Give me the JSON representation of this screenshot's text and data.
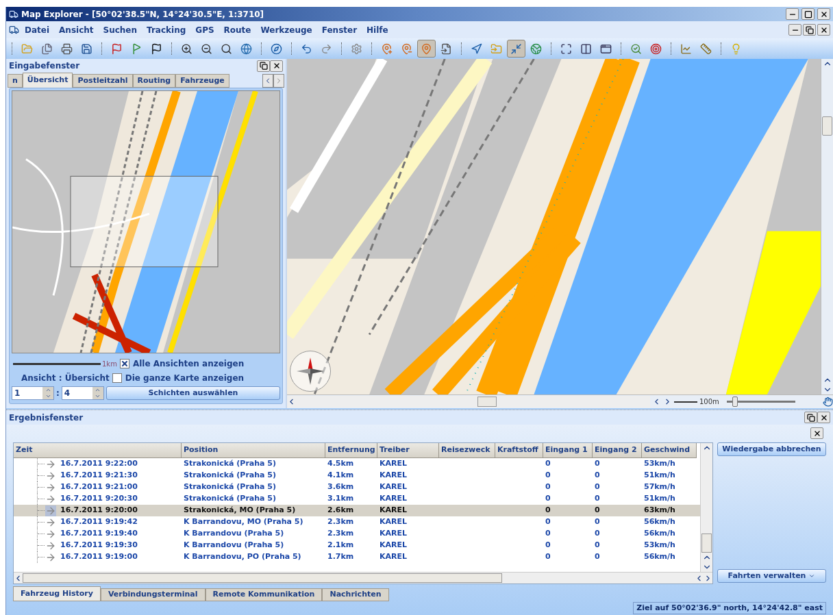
{
  "window": {
    "title": "Map Explorer - [50°02'38.5\"N, 14°24'30.5\"E, 1:3710]"
  },
  "menu": [
    "Datei",
    "Ansicht",
    "Suchen",
    "Tracking",
    "GPS",
    "Route",
    "Werkzeuge",
    "Fenster",
    "Hilfe"
  ],
  "toolbar": [
    {
      "kind": "separator"
    },
    {
      "kind": "open",
      "pressed": false
    },
    {
      "kind": "copy",
      "pressed": false
    },
    {
      "kind": "print",
      "pressed": false
    },
    {
      "kind": "save",
      "pressed": false
    },
    {
      "kind": "separator"
    },
    {
      "kind": "flag-start",
      "pressed": false
    },
    {
      "kind": "flag-via",
      "pressed": false
    },
    {
      "kind": "flag-finish",
      "pressed": false
    },
    {
      "kind": "separator"
    },
    {
      "kind": "zoom-in",
      "pressed": false
    },
    {
      "kind": "zoom-out",
      "pressed": false
    },
    {
      "kind": "zoom-100",
      "pressed": false
    },
    {
      "kind": "globe",
      "pressed": false
    },
    {
      "kind": "separator"
    },
    {
      "kind": "compass",
      "pressed": false
    },
    {
      "kind": "separator"
    },
    {
      "kind": "undo",
      "pressed": false
    },
    {
      "kind": "redo",
      "pressed": false
    },
    {
      "kind": "separator"
    },
    {
      "kind": "settings",
      "pressed": false
    },
    {
      "kind": "separator"
    },
    {
      "kind": "pin-add",
      "pressed": false
    },
    {
      "kind": "pin-remove",
      "pressed": false
    },
    {
      "kind": "pin",
      "pressed": true
    },
    {
      "kind": "document",
      "pressed": false
    },
    {
      "kind": "separator"
    },
    {
      "kind": "navigate",
      "pressed": false
    },
    {
      "kind": "folder",
      "pressed": false
    },
    {
      "kind": "fit",
      "pressed": true
    },
    {
      "kind": "globe-arrow",
      "pressed": false
    },
    {
      "kind": "separator"
    },
    {
      "kind": "fullscreen",
      "pressed": false
    },
    {
      "kind": "columns",
      "pressed": false
    },
    {
      "kind": "windows",
      "pressed": false
    },
    {
      "kind": "separator"
    },
    {
      "kind": "find",
      "pressed": false
    },
    {
      "kind": "target",
      "pressed": false
    },
    {
      "kind": "separator"
    },
    {
      "kind": "chart",
      "pressed": false
    },
    {
      "kind": "ruler",
      "pressed": false
    },
    {
      "kind": "separator"
    },
    {
      "kind": "bulb",
      "pressed": false
    }
  ],
  "input_panel": {
    "title": "Eingabefenster",
    "tabs": [
      {
        "label": "n",
        "selected": false
      },
      {
        "label": "Übersicht",
        "selected": true
      },
      {
        "label": "Postleitzahl",
        "selected": false
      },
      {
        "label": "Routing",
        "selected": false
      },
      {
        "label": "Fahrzeuge",
        "selected": false
      }
    ],
    "scale": "1km",
    "checkboxes": [
      {
        "label": "Alle Ansichten anzeigen",
        "checked": true
      },
      {
        "label": "Die ganze Karte anzeigen",
        "checked": false
      }
    ],
    "view_label": "Ansicht : Übersicht",
    "spinner_from": "1",
    "separator": ":",
    "spinner_to": "4",
    "layers_button": "Schichten auswählen"
  },
  "map": {
    "scale": "100m",
    "zoom": {
      "level": 0.12
    }
  },
  "results_panel": {
    "title": "Ergebnisfenster",
    "columns": [
      "Zeit",
      "Position",
      "Entfernung",
      "Treiber",
      "Reisezweck",
      "Kraftstoff",
      "Eingang 1",
      "Eingang 2",
      "Geschwind"
    ],
    "rows": [
      {
        "selected": false,
        "cells": [
          "16.7.2011 9:22:00",
          "Strakonická (Praha 5)",
          "4.5km",
          "KAREL",
          "",
          "",
          "0",
          "0",
          "53km/h"
        ]
      },
      {
        "selected": false,
        "cells": [
          "16.7.2011 9:21:30",
          "Strakonická (Praha 5)",
          "4.1km",
          "KAREL",
          "",
          "",
          "0",
          "0",
          "51km/h"
        ]
      },
      {
        "selected": false,
        "cells": [
          "16.7.2011 9:21:00",
          "Strakonická (Praha 5)",
          "3.6km",
          "KAREL",
          "",
          "",
          "0",
          "0",
          "57km/h"
        ]
      },
      {
        "selected": false,
        "cells": [
          "16.7.2011 9:20:30",
          "Strakonická (Praha 5)",
          "3.1km",
          "KAREL",
          "",
          "",
          "0",
          "0",
          "51km/h"
        ]
      },
      {
        "selected": true,
        "cells": [
          "16.7.2011 9:20:00",
          "Strakonická, MO (Praha 5)",
          "2.6km",
          "KAREL",
          "",
          "",
          "0",
          "0",
          "63km/h"
        ]
      },
      {
        "selected": false,
        "cells": [
          "16.7.2011 9:19:42",
          "K Barrandovu, MO (Praha 5)",
          "2.3km",
          "KAREL",
          "",
          "",
          "0",
          "0",
          "56km/h"
        ]
      },
      {
        "selected": false,
        "cells": [
          "16.7.2011 9:19:40",
          "K Barrandovu (Praha 5)",
          "2.3km",
          "KAREL",
          "",
          "",
          "0",
          "0",
          "56km/h"
        ]
      },
      {
        "selected": false,
        "cells": [
          "16.7.2011 9:19:30",
          "K Barrandovu (Praha 5)",
          "2.1km",
          "KAREL",
          "",
          "",
          "0",
          "0",
          "53km/h"
        ]
      },
      {
        "selected": false,
        "cells": [
          "16.7.2011 9:19:00",
          "K Barrandovu, PO (Praha 5)",
          "1.7km",
          "KAREL",
          "",
          "",
          "0",
          "0",
          "56km/h"
        ]
      }
    ],
    "buttons": [
      "Wiedergabe abbrechen",
      "Fahrten verwalten"
    ],
    "tabs": [
      {
        "label": "Fahrzeug History",
        "selected": true
      },
      {
        "label": "Verbindungsterminal",
        "selected": false
      },
      {
        "label": "Remote Kommunikation",
        "selected": false
      },
      {
        "label": "Nachrichten",
        "selected": false
      }
    ]
  },
  "status_bar": "Ziel auf 50°02'36.9\" north, 14°24'42.8\" east"
}
